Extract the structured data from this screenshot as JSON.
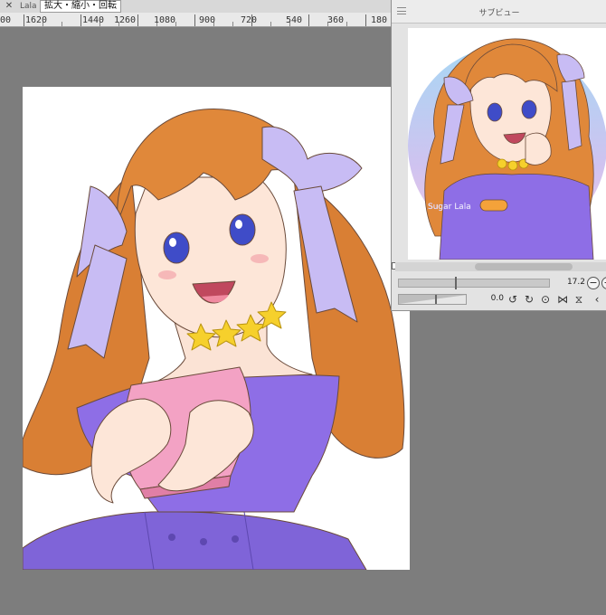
{
  "document_tab": {
    "title": "Lala",
    "close_glyph": "✕"
  },
  "tooltip": {
    "text": "拡大・縮小・回転"
  },
  "ruler": {
    "labels": [
      "00",
      "1620",
      "1440",
      "1260",
      "1080",
      "900",
      "720",
      "540",
      "360",
      "180"
    ]
  },
  "subview": {
    "title": "サブビュー",
    "zoom_value": "17.2",
    "rotation_value": "0.0",
    "signature": "Sugar Lala"
  },
  "colors": {
    "hair": "#e0883a",
    "ribbon": "#c8bcf4",
    "dress": "#8e6ee6",
    "book": "#f3a2c4",
    "stars": "#f6d02c"
  },
  "icons": {
    "zoom_out": "minus-circle-icon",
    "zoom_in": "plus-circle-icon",
    "rotate_left": "rotate-left-icon",
    "rotate_right": "rotate-right-icon",
    "reset_rotation": "reset-icon",
    "flip_horizontal": "flip-horizontal-icon",
    "flip_vertical": "flip-vertical-icon",
    "previous": "chevron-left-icon"
  }
}
